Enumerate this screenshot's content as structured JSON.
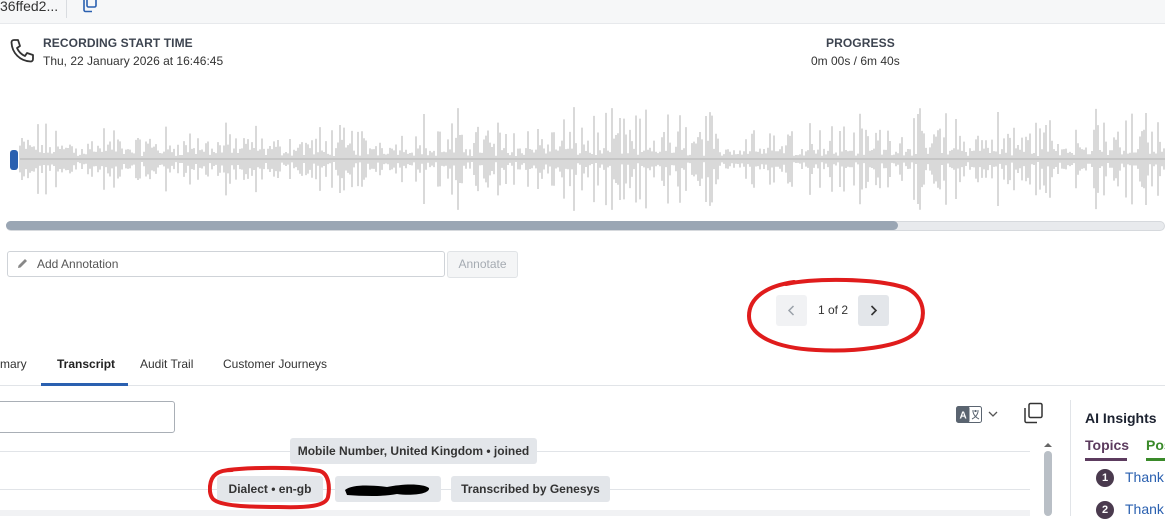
{
  "header": {
    "recording_id_fragment": "36ffed2..."
  },
  "recording": {
    "start_label": "RECORDING START TIME",
    "start_value": "Thu, 22 January 2026 at 16:46:45",
    "progress_label": "PROGRESS",
    "progress_value": "0m 00s / 6m 40s"
  },
  "playback": {
    "scrub_position_fraction": 0.0,
    "scroll_fraction": 0.77
  },
  "annotation": {
    "placeholder": "Add Annotation",
    "button_label": "Annotate"
  },
  "pagination": {
    "text": "1 of 2"
  },
  "tabs": [
    {
      "label": "mary"
    },
    {
      "label": "Transcript"
    },
    {
      "label": "Audit Trail"
    },
    {
      "label": "Customer Journeys"
    }
  ],
  "transcript": {
    "event_joined": "Mobile Number, United Kingdom • joined",
    "dialect": "Dialect • en-gb",
    "transcribed_by": "Transcribed by Genesys"
  },
  "ai_insights": {
    "title": "AI Insights",
    "tabs": [
      "Topics",
      "Pos"
    ],
    "items": [
      {
        "badge": "1",
        "label": "Thank"
      },
      {
        "badge": "2",
        "label": "Thank"
      }
    ]
  },
  "colors": {
    "accent_blue": "#2a60b0",
    "waveform": "#b3b3b3",
    "highlight_red": "#e01c1c",
    "topics": "#5c3b5e",
    "positive": "#3a8a2a"
  }
}
